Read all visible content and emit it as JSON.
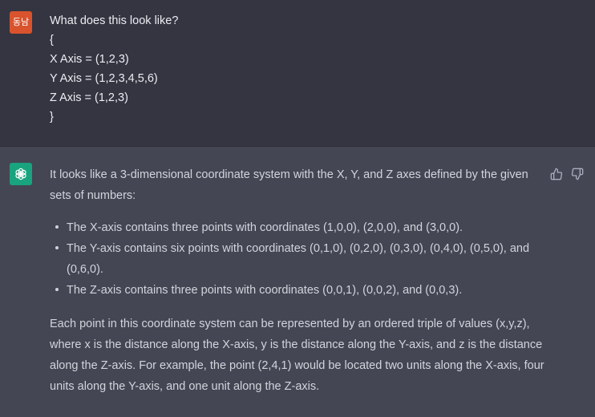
{
  "user_message": {
    "avatar_initials": "동남",
    "avatar_color": "#d9532d",
    "lines": [
      "What does this look like?",
      "{",
      "X Axis = (1,2,3)",
      "Y Axis = (1,2,3,4,5,6)",
      "Z Axis = (1,2,3)",
      "}"
    ]
  },
  "assistant_message": {
    "avatar_icon": "openai-logo-icon",
    "avatar_color": "#19a37e",
    "intro": "It looks like a 3-dimensional coordinate system with the X, Y, and Z axes defined by the given sets of numbers:",
    "bullets": [
      "The X-axis contains three points with coordinates (1,0,0), (2,0,0), and (3,0,0).",
      "The Y-axis contains six points with coordinates (0,1,0), (0,2,0), (0,3,0), (0,4,0), (0,5,0), and (0,6,0).",
      "The Z-axis contains three points with coordinates (0,0,1), (0,0,2), and (0,0,3)."
    ],
    "closing": "Each point in this coordinate system can be represented by an ordered triple of values (x,y,z), where x is the distance along the X-axis, y is the distance along the Y-axis, and z is the distance along the Z-axis. For example, the point (2,4,1) would be located two units along the X-axis, four units along the Y-axis, and one unit along the Z-axis."
  },
  "actions": {
    "thumbs_up_icon": "thumbs-up-icon",
    "thumbs_down_icon": "thumbs-down-icon"
  }
}
